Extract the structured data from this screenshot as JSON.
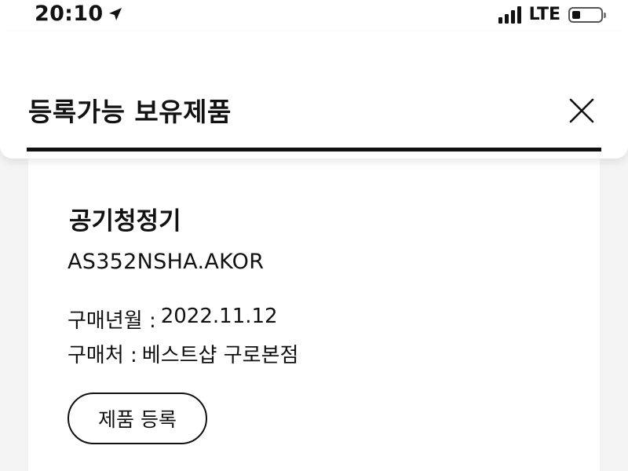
{
  "status_bar": {
    "time": "20:10",
    "network": "LTE",
    "battery_level": 0.3,
    "signal_bars": 4,
    "icons": [
      "location-arrow-icon",
      "signal-icon",
      "battery-icon"
    ]
  },
  "header": {
    "title": "등록가능 보유제품",
    "close_icon": "close-icon"
  },
  "product": {
    "name": "공기청정기",
    "model": "AS352NSHA.AKOR",
    "purchase_date_label": "구매년월 :",
    "purchase_date": "2022.11.12",
    "store_label": "구매처 :",
    "store": "베스트샵 구로본점",
    "register_button_label": "제품 등록"
  },
  "colors": {
    "text": "#111111",
    "background": "#f4f4f4",
    "card": "#ffffff"
  }
}
